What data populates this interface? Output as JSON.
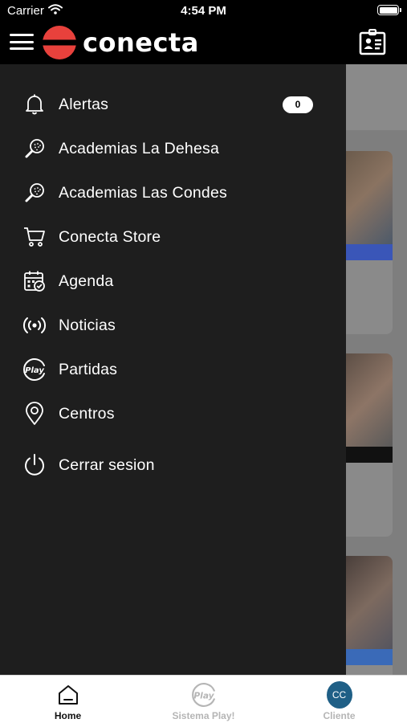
{
  "status_bar": {
    "carrier": "Carrier",
    "time": "4:54 PM"
  },
  "header": {
    "brand": "conecta",
    "menu_icon": "hamburger-menu-icon",
    "action_icon": "id-card-icon"
  },
  "drawer": {
    "items": [
      {
        "label": "Alertas",
        "icon": "bell-icon",
        "badge": "0"
      },
      {
        "label": "Academias La Dehesa",
        "icon": "padel-racket-icon"
      },
      {
        "label": "Academias Las Condes",
        "icon": "padel-racket-icon"
      },
      {
        "label": "Conecta Store",
        "icon": "shopping-cart-icon"
      },
      {
        "label": "Agenda",
        "icon": "calendar-check-icon"
      },
      {
        "label": "Noticias",
        "icon": "broadcast-icon"
      },
      {
        "label": "Partidas",
        "icon": "play-badge-icon"
      },
      {
        "label": "Centros",
        "icon": "location-pin-icon"
      },
      {
        "label": "Cerrar sesion",
        "icon": "power-icon"
      }
    ]
  },
  "tab_bar": {
    "tabs": [
      {
        "label": "Home",
        "icon": "home-icon",
        "active": true
      },
      {
        "label": "Sistema Play!",
        "icon": "play-badge-icon",
        "active": false
      },
      {
        "label": "Cliente",
        "icon": "avatar",
        "initials": "CC",
        "active": false
      }
    ]
  },
  "colors": {
    "drawer_bg": "#1e1e1e",
    "header_bg": "#000000",
    "brand_red": "#e8413c",
    "tab_active": "#111111",
    "tab_inactive": "#b5b5b5",
    "avatar_bg": "#1f5f86",
    "card_strip_blue": "#3a56b8"
  }
}
